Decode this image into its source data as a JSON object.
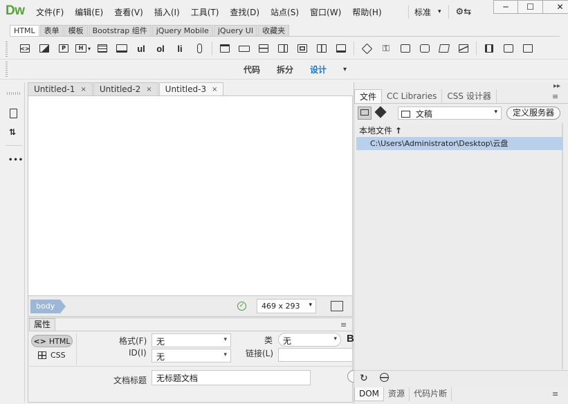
{
  "app": {
    "logo": "Dw"
  },
  "menus": [
    "文件(F)",
    "编辑(E)",
    "查看(V)",
    "插入(I)",
    "工具(T)",
    "查找(D)",
    "站点(S)",
    "窗口(W)",
    "帮助(H)"
  ],
  "workspace": {
    "label": "标准",
    "dropdown_glyph": "▾",
    "sync_glyph": "⚙⇆"
  },
  "window_buttons": {
    "minimize": "─",
    "maximize": "☐",
    "close": "✕"
  },
  "insert_tabs": [
    "HTML",
    "表单",
    "模板",
    "Bootstrap 组件",
    "jQuery Mobile",
    "jQuery UI",
    "收藏夹"
  ],
  "insert_tab_active": 0,
  "insert_icons": {
    "heading_label": "H",
    "ul_label": "ul",
    "ol_label": "ol",
    "li_label": "li"
  },
  "view_buttons": [
    "代码",
    "拆分",
    "设计"
  ],
  "view_active": 2,
  "view_caret": "▾",
  "left_tools": {
    "more_label": "•••"
  },
  "doc_tabs": [
    {
      "title": "Untitled-1",
      "close": "×"
    },
    {
      "title": "Untitled-2",
      "close": "×"
    },
    {
      "title": "Untitled-3",
      "close": "×"
    }
  ],
  "doc_tab_active": 2,
  "status": {
    "tag": "body",
    "window_size": "469 x 293",
    "dropdown_glyph": "▾",
    "valid_glyph": "✓"
  },
  "properties": {
    "panel_title": "属性",
    "menu_glyph": "≡",
    "html_button": "HTML",
    "css_button": "CSS",
    "format_label": "格式(F)",
    "format_value": "无",
    "id_label": "ID(I)",
    "id_value": "无",
    "class_label": "类",
    "class_value": "无",
    "link_label": "链接(L)",
    "link_value": "",
    "title_label": "文档标题",
    "title_value": "无标题文档",
    "dropdown_glyph": "▾",
    "bold_glyph": "B"
  },
  "right_panel": {
    "collapse_glyph": "▸▸",
    "tabs": [
      "文件",
      "CC Libraries",
      "CSS 设计器"
    ],
    "tab_active": 0,
    "menu_glyph": "≡",
    "site": "文稿",
    "define_server": "定义服务器",
    "files_header": "本地文件",
    "sort_glyph": "↑",
    "file_path": "C:\\Users\\Administrator\\Desktop\\云盘",
    "dropdown_glyph": "▾",
    "refresh_glyph": "↻",
    "bottom_tabs": [
      "DOM",
      "资源",
      "代码片断"
    ],
    "bottom_tab_active": 0
  }
}
